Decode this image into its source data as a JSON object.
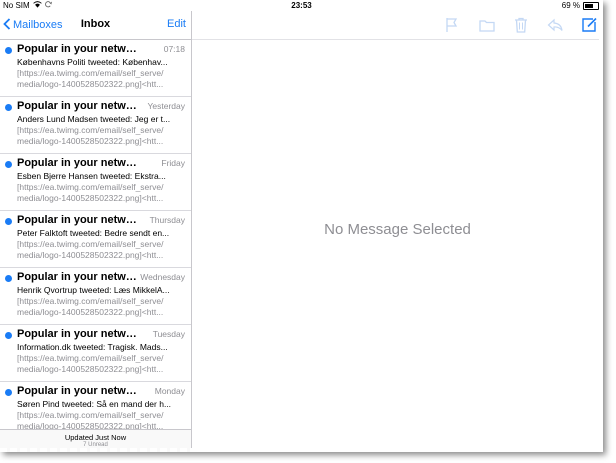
{
  "status_bar": {
    "carrier": "No SIM",
    "time": "23:53",
    "battery": "69 %",
    "battery_level": 0.69
  },
  "colors": {
    "accent": "#1a7cf5",
    "unread_dot": "#1a7cf5",
    "secondary_text": "#8e8e93"
  },
  "left_pane": {
    "back_label": "Mailboxes",
    "title": "Inbox",
    "edit_label": "Edit",
    "messages": [
      {
        "sender": "Popular in your network",
        "date": "07:18",
        "subject": "Københavns Politi tweeted: Københav...",
        "preview1": "[https://ea.twimg.com/email/self_serve/",
        "preview2": "media/logo-1400528502322.png]<htt..."
      },
      {
        "sender": "Popular in your network",
        "date": "Yesterday",
        "subject": "Anders Lund Madsen tweeted: Jeg er t...",
        "preview1": "[https://ea.twimg.com/email/self_serve/",
        "preview2": "media/logo-1400528502322.png]<htt..."
      },
      {
        "sender": "Popular in your network",
        "date": "Friday",
        "subject": "Esben Bjerre Hansen tweeted: Ekstra...",
        "preview1": "[https://ea.twimg.com/email/self_serve/",
        "preview2": "media/logo-1400528502322.png]<htt..."
      },
      {
        "sender": "Popular in your network",
        "date": "Thursday",
        "subject": "Peter Falktoft tweeted: Bedre sendt en...",
        "preview1": "[https://ea.twimg.com/email/self_serve/",
        "preview2": "media/logo-1400528502322.png]<htt..."
      },
      {
        "sender": "Popular in your netwo...",
        "date": "Wednesday",
        "subject": "Henrik Qvortrup tweeted: Læs MikkelA...",
        "preview1": "[https://ea.twimg.com/email/self_serve/",
        "preview2": "media/logo-1400528502322.png]<htt..."
      },
      {
        "sender": "Popular in your network",
        "date": "Tuesday",
        "subject": "Information.dk tweeted: Tragisk. Mads...",
        "preview1": "[https://ea.twimg.com/email/self_serve/",
        "preview2": "media/logo-1400528502322.png]<htt..."
      },
      {
        "sender": "Popular in your network",
        "date": "Monday",
        "subject": "Søren Pind tweeted: Så en mand der h...",
        "preview1": "[https://ea.twimg.com/email/self_serve/",
        "preview2": "media/logo-1400528502322.png]<htt..."
      }
    ],
    "footer_updated": "Updated Just Now",
    "footer_unread": "7 Unread"
  },
  "right_pane": {
    "empty_message": "No Message Selected",
    "toolbar_icons": [
      "flag-icon",
      "folder-icon",
      "trash-icon",
      "reply-icon",
      "compose-icon"
    ]
  }
}
